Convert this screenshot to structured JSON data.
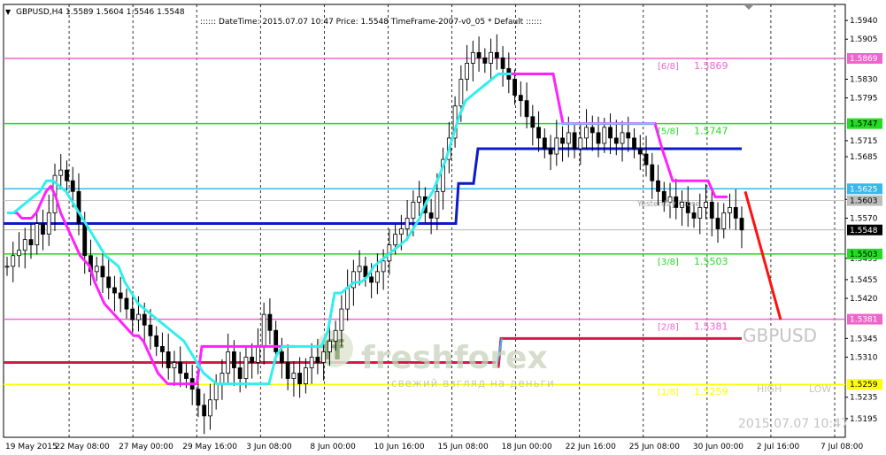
{
  "header": {
    "symbol_info": "GBPUSD,H4  1.5589 1.5604 1.5546 1.5548",
    "info_line": ":::::: DateTime: 2015.07.07 10:47    Price: 1.5548    TimeFrame-2007-v0_05    *  Default  ::::::"
  },
  "watermark": {
    "brand": "freshforex",
    "slogan": "свежий взгляд на деньги",
    "symbol": "GBPUSD",
    "high_label": "HIGH",
    "low_label": "LOW",
    "timestamp": "2015.07.07 10:47"
  },
  "yesterday_label": "Yesterday Close",
  "colors": {
    "candles": "#000000",
    "magenta": "#ff22ff",
    "cyan": "#33eeee",
    "blue": "#0b1bc8",
    "crimson": "#d41a4a",
    "red_arrow": "#ff1010",
    "murrey_pink": "#ee66cc",
    "murrey_green": "#22dd22",
    "murrey_sky": "#33bbee",
    "murrey_yellow": "#ffff00",
    "grid": "#000000"
  },
  "chart_data": {
    "type": "candlestick",
    "x_ticks": [
      "19 May 2015",
      "22 May 08:00",
      "27 May 00:00",
      "29 May 16:00",
      "3 Jun 08:00",
      "8 Jun 00:00",
      "10 Jun 16:00",
      "15 Jun 08:00",
      "18 Jun 00:00",
      "22 Jun 16:00",
      "25 Jun 08:00",
      "30 Jun 00:00",
      "2 Jul 16:00",
      "7 Jul 08:00"
    ],
    "y_ticks": [
      "1.5940",
      "1.5905",
      "1.5830",
      "1.5795",
      "1.5715",
      "1.5685",
      "1.5605",
      "1.5570",
      "1.5495",
      "1.5455",
      "1.5420",
      "1.5345",
      "1.5310",
      "1.5235",
      "1.5195"
    ],
    "ylim": [
      1.516,
      1.597
    ],
    "price_labels": [
      {
        "text": "1.5869",
        "value": 1.5869,
        "kind": "pink"
      },
      {
        "text": "1.5747",
        "value": 1.5747,
        "kind": "green"
      },
      {
        "text": "1.5625",
        "value": 1.5625,
        "kind": "sky"
      },
      {
        "text": "1.5603",
        "value": 1.5603,
        "kind": "gray"
      },
      {
        "text": "1.5548",
        "value": 1.5548,
        "kind": "current"
      },
      {
        "text": "1.5503",
        "value": 1.5503,
        "kind": "green"
      },
      {
        "text": "1.5381",
        "value": 1.5381,
        "kind": "pink"
      },
      {
        "text": "1.5259",
        "value": 1.5259,
        "kind": "yellow"
      }
    ],
    "murrey_levels": [
      {
        "frac": "[6/8]",
        "value": "1.5869",
        "price": 1.5869,
        "kind": "pink"
      },
      {
        "frac": "[5/8]",
        "value": "1.5747",
        "price": 1.5747,
        "kind": "green"
      },
      {
        "frac": "[3/8]",
        "value": "1.5503",
        "price": 1.5503,
        "kind": "green"
      },
      {
        "frac": "[2/8]",
        "value": "1.5381",
        "price": 1.5381,
        "kind": "pink"
      },
      {
        "frac": "[1/8]",
        "value": "1.5259",
        "price": 1.5259,
        "kind": "yellow"
      }
    ],
    "current_price": 1.5548,
    "yesterday_close": 1.5603,
    "sky_level": 1.5625,
    "blue_level_low": 1.556,
    "blue_level_high": 1.57,
    "crimson_level": 1.53,
    "crimson_level_high": 1.5345,
    "close_series": [
      1.548,
      1.55,
      1.551,
      1.553,
      1.552,
      1.556,
      1.554,
      1.558,
      1.565,
      1.566,
      1.564,
      1.562,
      1.556,
      1.55,
      1.547,
      1.548,
      1.546,
      1.544,
      1.543,
      1.542,
      1.54,
      1.538,
      1.539,
      1.537,
      1.535,
      1.533,
      1.532,
      1.529,
      1.53,
      1.528,
      1.527,
      1.525,
      1.522,
      1.52,
      1.523,
      1.526,
      1.528,
      1.532,
      1.529,
      1.527,
      1.531,
      1.53,
      1.533,
      1.539,
      1.536,
      1.532,
      1.53,
      1.527,
      1.528,
      1.526,
      1.529,
      1.531,
      1.53,
      1.532,
      1.534,
      1.536,
      1.54,
      1.544,
      1.547,
      1.548,
      1.546,
      1.545,
      1.547,
      1.549,
      1.552,
      1.554,
      1.555,
      1.557,
      1.56,
      1.561,
      1.558,
      1.557,
      1.562,
      1.568,
      1.572,
      1.578,
      1.583,
      1.586,
      1.588,
      1.587,
      1.586,
      1.588,
      1.587,
      1.585,
      1.583,
      1.58,
      1.579,
      1.576,
      1.574,
      1.572,
      1.57,
      1.569,
      1.572,
      1.571,
      1.573,
      1.57,
      1.572,
      1.574,
      1.573,
      1.571,
      1.574,
      1.572,
      1.571,
      1.573,
      1.572,
      1.57,
      1.569,
      1.567,
      1.564,
      1.562,
      1.56,
      1.561,
      1.559,
      1.56,
      1.558,
      1.557,
      1.559,
      1.56,
      1.557,
      1.555,
      1.558,
      1.559,
      1.557,
      1.5548
    ],
    "magenta_series": [
      1.558,
      1.558,
      1.558,
      1.557,
      1.557,
      1.557,
      1.558,
      1.56,
      1.562,
      1.563,
      1.561,
      1.558,
      1.556,
      1.554,
      1.552,
      1.55,
      1.549,
      1.548,
      1.545,
      1.543,
      1.541,
      1.54,
      1.539,
      1.538,
      1.537,
      1.536,
      1.535,
      1.535,
      1.534,
      1.532,
      1.53,
      1.528,
      1.527,
      1.526,
      1.526,
      1.526,
      1.526,
      1.526,
      1.526,
      1.526,
      1.533,
      1.533,
      1.533,
      1.533,
      1.533,
      1.533,
      1.533,
      1.533,
      1.533,
      1.533,
      1.533,
      1.533,
      1.533,
      1.533,
      1.533,
      1.533,
      1.533,
      1.533,
      1.533,
      1.533
    ],
    "cyan_series": [
      1.558,
      1.558,
      1.559,
      1.56,
      1.561,
      1.562,
      1.564,
      1.564,
      1.563,
      1.562,
      1.56,
      1.558,
      1.556,
      1.554,
      1.552,
      1.55,
      1.549,
      1.548,
      1.545,
      1.543,
      1.541,
      1.54,
      1.539,
      1.538,
      1.537,
      1.536,
      1.535,
      1.534,
      1.532,
      1.53,
      1.528,
      1.527,
      1.526,
      1.526,
      1.526,
      1.526,
      1.526,
      1.526,
      1.526,
      1.526,
      1.526,
      1.531,
      1.533,
      1.533,
      1.533,
      1.533,
      1.533,
      1.533,
      1.533,
      1.536,
      1.543,
      1.543,
      1.544,
      1.545,
      1.545,
      1.546,
      1.548,
      1.549,
      1.55,
      1.551,
      1.552,
      1.553,
      1.555,
      1.557,
      1.56,
      1.562,
      1.565,
      1.568,
      1.572,
      1.576,
      1.579,
      1.58,
      1.581,
      1.582,
      1.583,
      1.584,
      1.584,
      1.584
    ]
  }
}
